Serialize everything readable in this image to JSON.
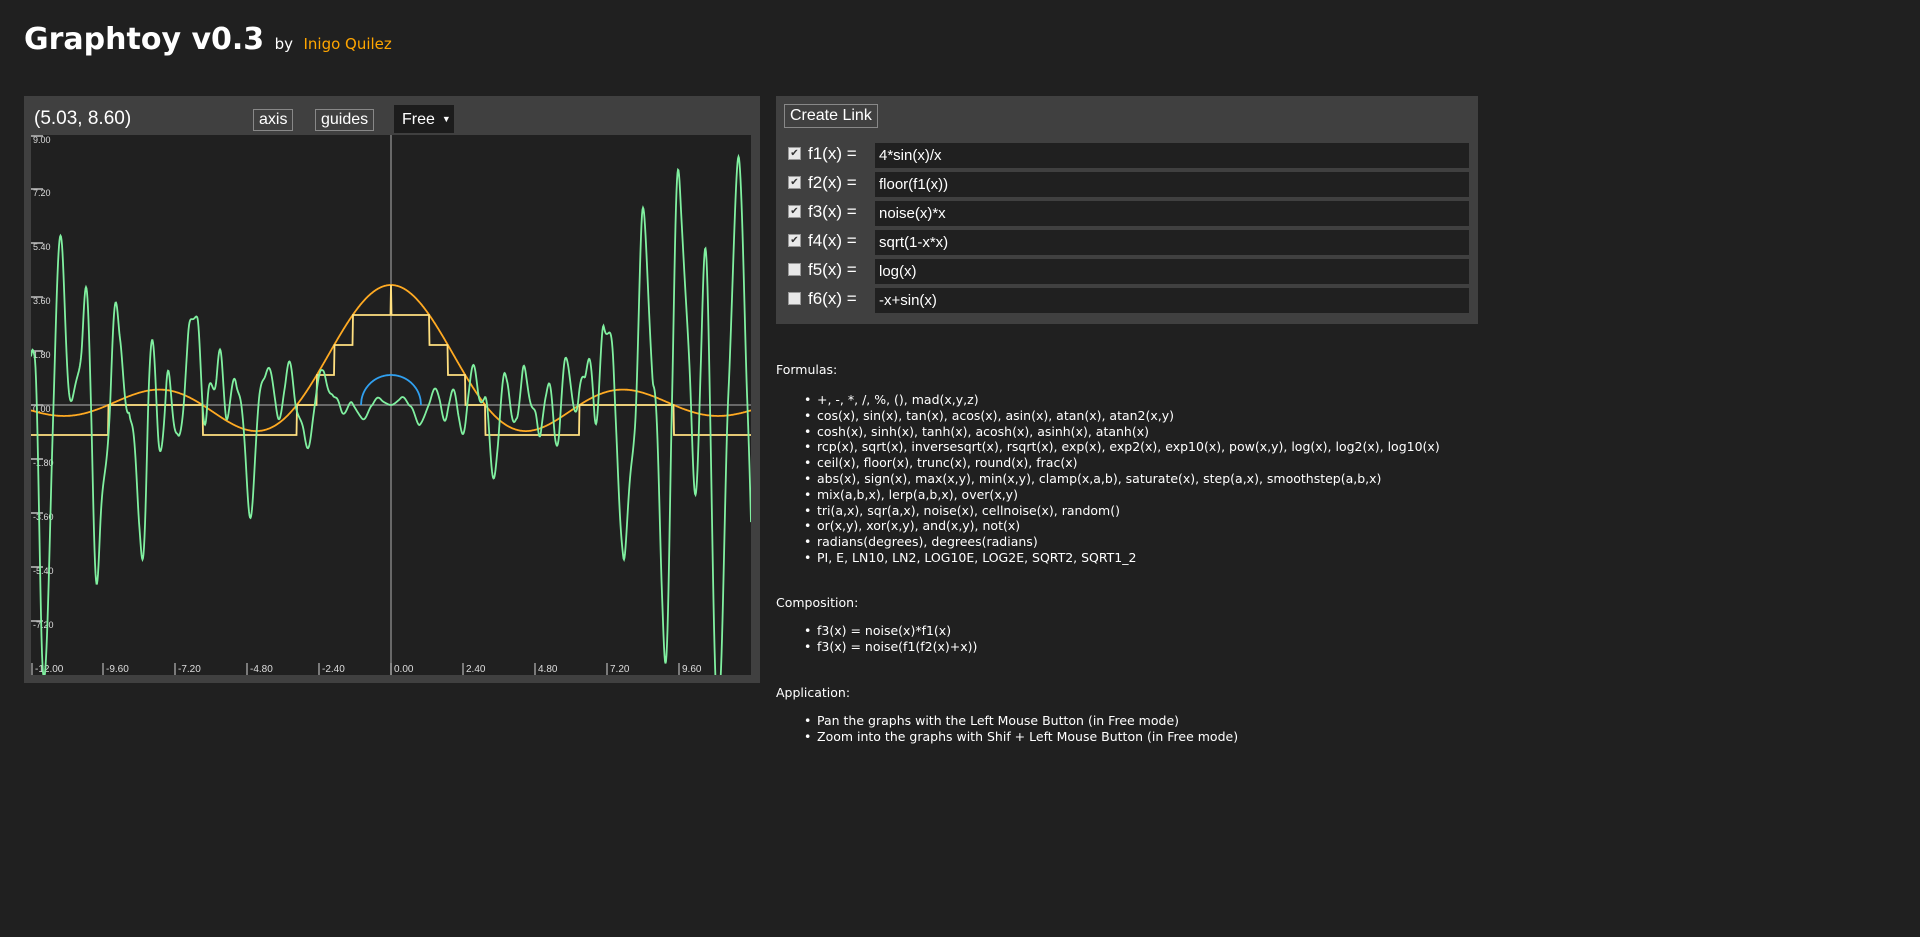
{
  "header": {
    "title": "Graphtoy v0.3",
    "by": "by",
    "author": "Inigo Quilez",
    "author_color": "#ffa500"
  },
  "graph": {
    "coords": "(5.03, 8.60)",
    "axis_label": "axis",
    "guides_label": "guides",
    "mode": "Free",
    "mode_icon": "triangle-down",
    "background": "#202020",
    "axis_color": "#808080"
  },
  "chart_data": {
    "type": "line",
    "xlim": [
      -12,
      12
    ],
    "ylim": [
      -9,
      9
    ],
    "x_ticks": [
      "-12.00",
      "-9.60",
      "-7.20",
      "-4.80",
      "-2.40",
      "0.00",
      "2.40",
      "4.80",
      "7.20",
      "9.60"
    ],
    "y_ticks": [
      "9.00",
      "7.20",
      "5.40",
      "3.60",
      "1.80",
      "0.00",
      "-1.80",
      "-3.60",
      "-5.40",
      "-7.20"
    ],
    "series": [
      {
        "expr": "4*sin(x)/x",
        "color": "#ffaa22"
      },
      {
        "expr": "floor(f1(x))",
        "color": "#ffe080"
      },
      {
        "expr": "noise(x)*x",
        "color": "#80f0a0"
      },
      {
        "expr": "sqrt(1-x*x)",
        "color": "#30a0f0"
      }
    ]
  },
  "editor": {
    "create_link": "Create Link",
    "functions": [
      {
        "label": "f1(x) =",
        "value": "4*sin(x)/x",
        "enabled": true
      },
      {
        "label": "f2(x) =",
        "value": "floor(f1(x))",
        "enabled": true
      },
      {
        "label": "f3(x) =",
        "value": "noise(x)*x",
        "enabled": true
      },
      {
        "label": "f4(x) =",
        "value": "sqrt(1-x*x)",
        "enabled": true
      },
      {
        "label": "f5(x) =",
        "value": "log(x)",
        "enabled": false
      },
      {
        "label": "f6(x) =",
        "value": "-x+sin(x)",
        "enabled": false
      }
    ]
  },
  "help": {
    "formulas_title": "Formulas:",
    "formulas": [
      "+, -, *, /, %, (), mad(x,y,z)",
      "cos(x), sin(x), tan(x), acos(x), asin(x), atan(x), atan2(x,y)",
      "cosh(x), sinh(x), tanh(x), acosh(x), asinh(x), atanh(x)",
      "rcp(x), sqrt(x), inversesqrt(x), rsqrt(x), exp(x), exp2(x), exp10(x), pow(x,y), log(x), log2(x), log10(x)",
      "ceil(x), floor(x), trunc(x), round(x), frac(x)",
      "abs(x), sign(x), max(x,y), min(x,y), clamp(x,a,b), saturate(x), step(a,x), smoothstep(a,b,x)",
      "mix(a,b,x), lerp(a,b,x), over(x,y)",
      "tri(a,x), sqr(a,x), noise(x), cellnoise(x), random()",
      "or(x,y), xor(x,y), and(x,y), not(x)",
      "radians(degrees), degrees(radians)",
      "PI, E, LN10, LN2, LOG10E, LOG2E, SQRT2, SQRT1_2"
    ],
    "composition_title": "Composition:",
    "composition": [
      "f3(x) = noise(x)*f1(x)",
      "f3(x) = noise(f1(f2(x)+x))"
    ],
    "application_title": "Application:",
    "application": [
      "Pan the graphs with the Left Mouse Button (in Free mode)",
      "Zoom into the graphs with Shif + Left Mouse Button (in Free mode)"
    ]
  }
}
